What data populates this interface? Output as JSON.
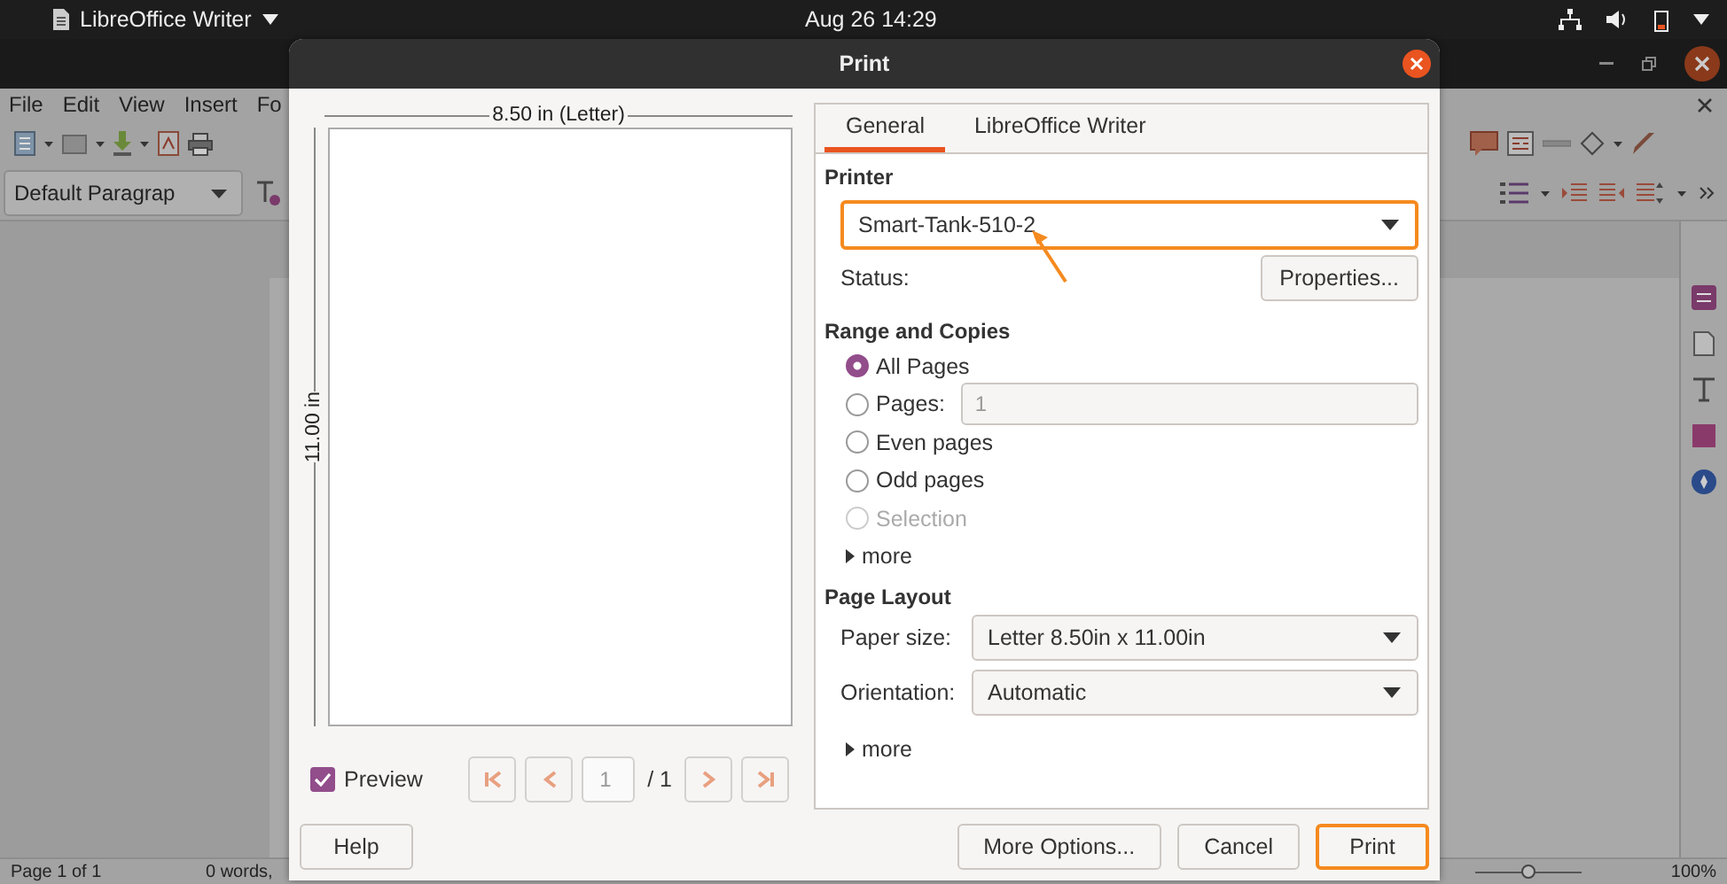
{
  "system_bar": {
    "app_name": "LibreOffice Writer",
    "clock": "Aug 26  14:29"
  },
  "writer": {
    "menu": [
      "File",
      "Edit",
      "View",
      "Insert",
      "Fo"
    ],
    "paragraph_style": "Default Paragrap",
    "status_bar": {
      "page": "Page 1 of 1",
      "words": "0 words,",
      "zoom": "100%",
      "zoom_slider": {
        "level": 0.5
      }
    }
  },
  "dialog": {
    "title": "Print",
    "preview": {
      "width_label": "8.50 in (Letter)",
      "height_label": "11.00 in",
      "show_preview": {
        "label": "Preview",
        "checked": true
      },
      "page_field": "1",
      "page_total": "/ 1"
    },
    "tabs": [
      {
        "label": "General",
        "selected": true
      },
      {
        "label": "LibreOffice Writer",
        "selected": false
      }
    ],
    "printer": {
      "heading": "Printer",
      "selected_printer": "Smart-Tank-510-2",
      "highlighted": true,
      "status_label": "Status:",
      "properties_button": "Properties..."
    },
    "range": {
      "heading": "Range and Copies",
      "options": [
        {
          "kind": "plain",
          "label": "All Pages",
          "selected": true,
          "disabled": false
        },
        {
          "kind": "field",
          "label": "Pages:",
          "selected": false,
          "disabled": false,
          "field_value": "1",
          "field_disabled": true
        },
        {
          "kind": "plain",
          "label": "Even pages",
          "selected": false,
          "disabled": false
        },
        {
          "kind": "plain",
          "label": "Odd pages",
          "selected": false,
          "disabled": false
        },
        {
          "kind": "plain",
          "label": "Selection",
          "selected": false,
          "disabled": true
        }
      ],
      "more": "more"
    },
    "layout": {
      "heading": "Page Layout",
      "rows": [
        {
          "label": "Paper size:",
          "value": "Letter 8.50in x 11.00in"
        },
        {
          "label": "Orientation:",
          "value": "Automatic"
        }
      ],
      "more": "more"
    },
    "buttons": [
      {
        "kind": "left",
        "label": "Help",
        "highlighted": false
      },
      {
        "kind": "right",
        "label": "More Options...",
        "highlighted": false
      },
      {
        "kind": "right",
        "label": "Cancel",
        "highlighted": false
      },
      {
        "kind": "right",
        "label": "Print",
        "highlighted": true
      }
    ]
  }
}
